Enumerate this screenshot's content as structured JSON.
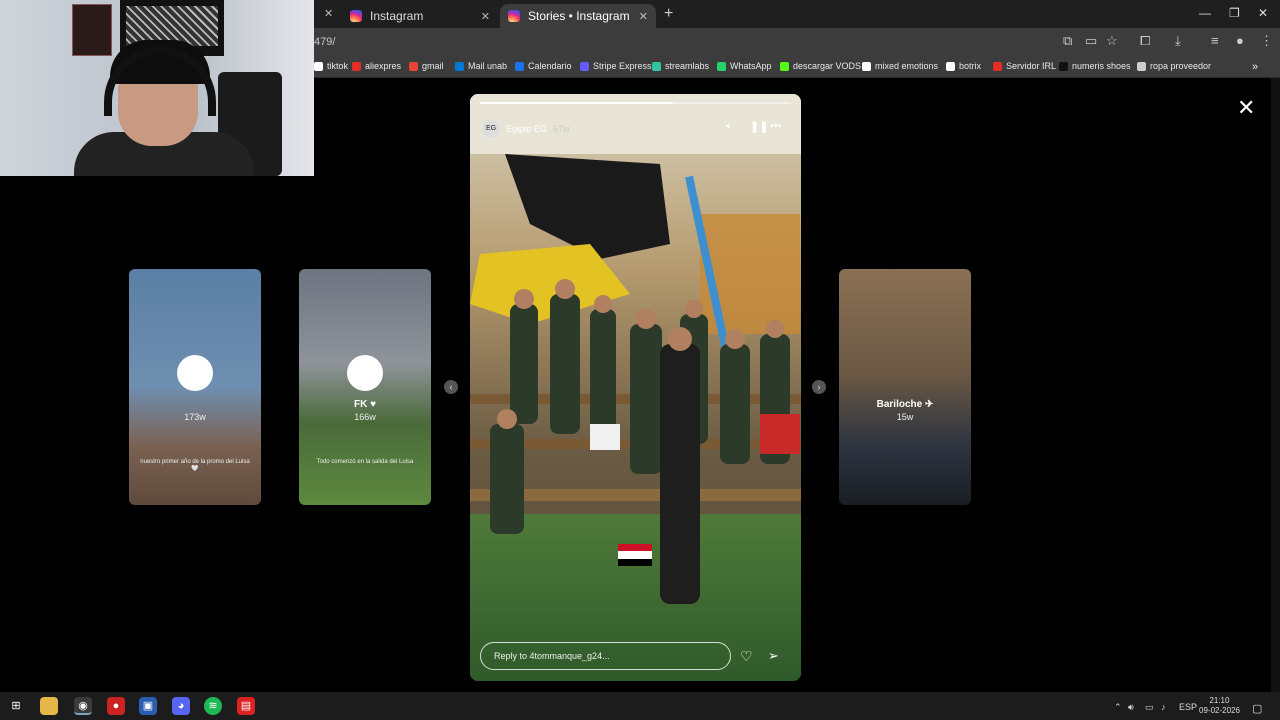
{
  "browser": {
    "tabs": [
      {
        "title": "Instagram",
        "active": false
      },
      {
        "title": "Stories • Instagram",
        "active": true
      }
    ],
    "address": "479/",
    "bookmarks": [
      {
        "label": "tiktok",
        "color": "#ffffff"
      },
      {
        "label": "aliexpres",
        "color": "#e52d27"
      },
      {
        "label": "gmail",
        "color": "#ea4335"
      },
      {
        "label": "Mail unab",
        "color": "#0078d4"
      },
      {
        "label": "Calendario",
        "color": "#1a73e8"
      },
      {
        "label": "Stripe Express",
        "color": "#635bff"
      },
      {
        "label": "streamlabs",
        "color": "#31c3a2"
      },
      {
        "label": "WhatsApp",
        "color": "#25d366"
      },
      {
        "label": "descargar VODS",
        "color": "#53fc18"
      },
      {
        "label": "mixed emotions",
        "color": "#ffffff"
      },
      {
        "label": "botrix",
        "color": "#ffffff"
      },
      {
        "label": "Servidor IRL",
        "color": "#e52d27"
      },
      {
        "label": "numeris shoes",
        "color": "#111111"
      },
      {
        "label": "ropa proveedor",
        "color": "#cccccc"
      }
    ]
  },
  "viewer": {
    "close_label": "✕",
    "side_stories": [
      {
        "username": "",
        "age": "173w",
        "caption": "nuestro primer año de la promo del Luisa 🤍",
        "bg": "linear-gradient(180deg,#5b7fa5 0%,#6f8fb0 50%,#7a6252 75%,#5e4a3d 100%)"
      },
      {
        "username": "FK ♥",
        "age": "166w",
        "caption": "Todo comenzó en la salida del Luisa",
        "bg": "linear-gradient(180deg,#6e7480 0%,#8e949a 40%,#4b6a3a 65%,#5c8a3e 100%)"
      },
      {
        "username": "Bariloche ✈",
        "age": "15w",
        "caption": "",
        "bg": "linear-gradient(180deg,#8a7054 0%,#6a5844 45%,#2d3440 75%,#1a1e24 100%)"
      }
    ],
    "story": {
      "username": "Egipto EG",
      "age": "67w",
      "avatar_text": "EG",
      "progress": 0.62,
      "reply_placeholder": "Reply to 4tommanque_g24...",
      "icons": [
        "mute-icon",
        "pause-icon",
        "more-icon",
        "heart-icon",
        "send-icon"
      ]
    }
  },
  "taskbar": {
    "language": "ESP",
    "time": "21:10",
    "date": "09-02-2026"
  }
}
